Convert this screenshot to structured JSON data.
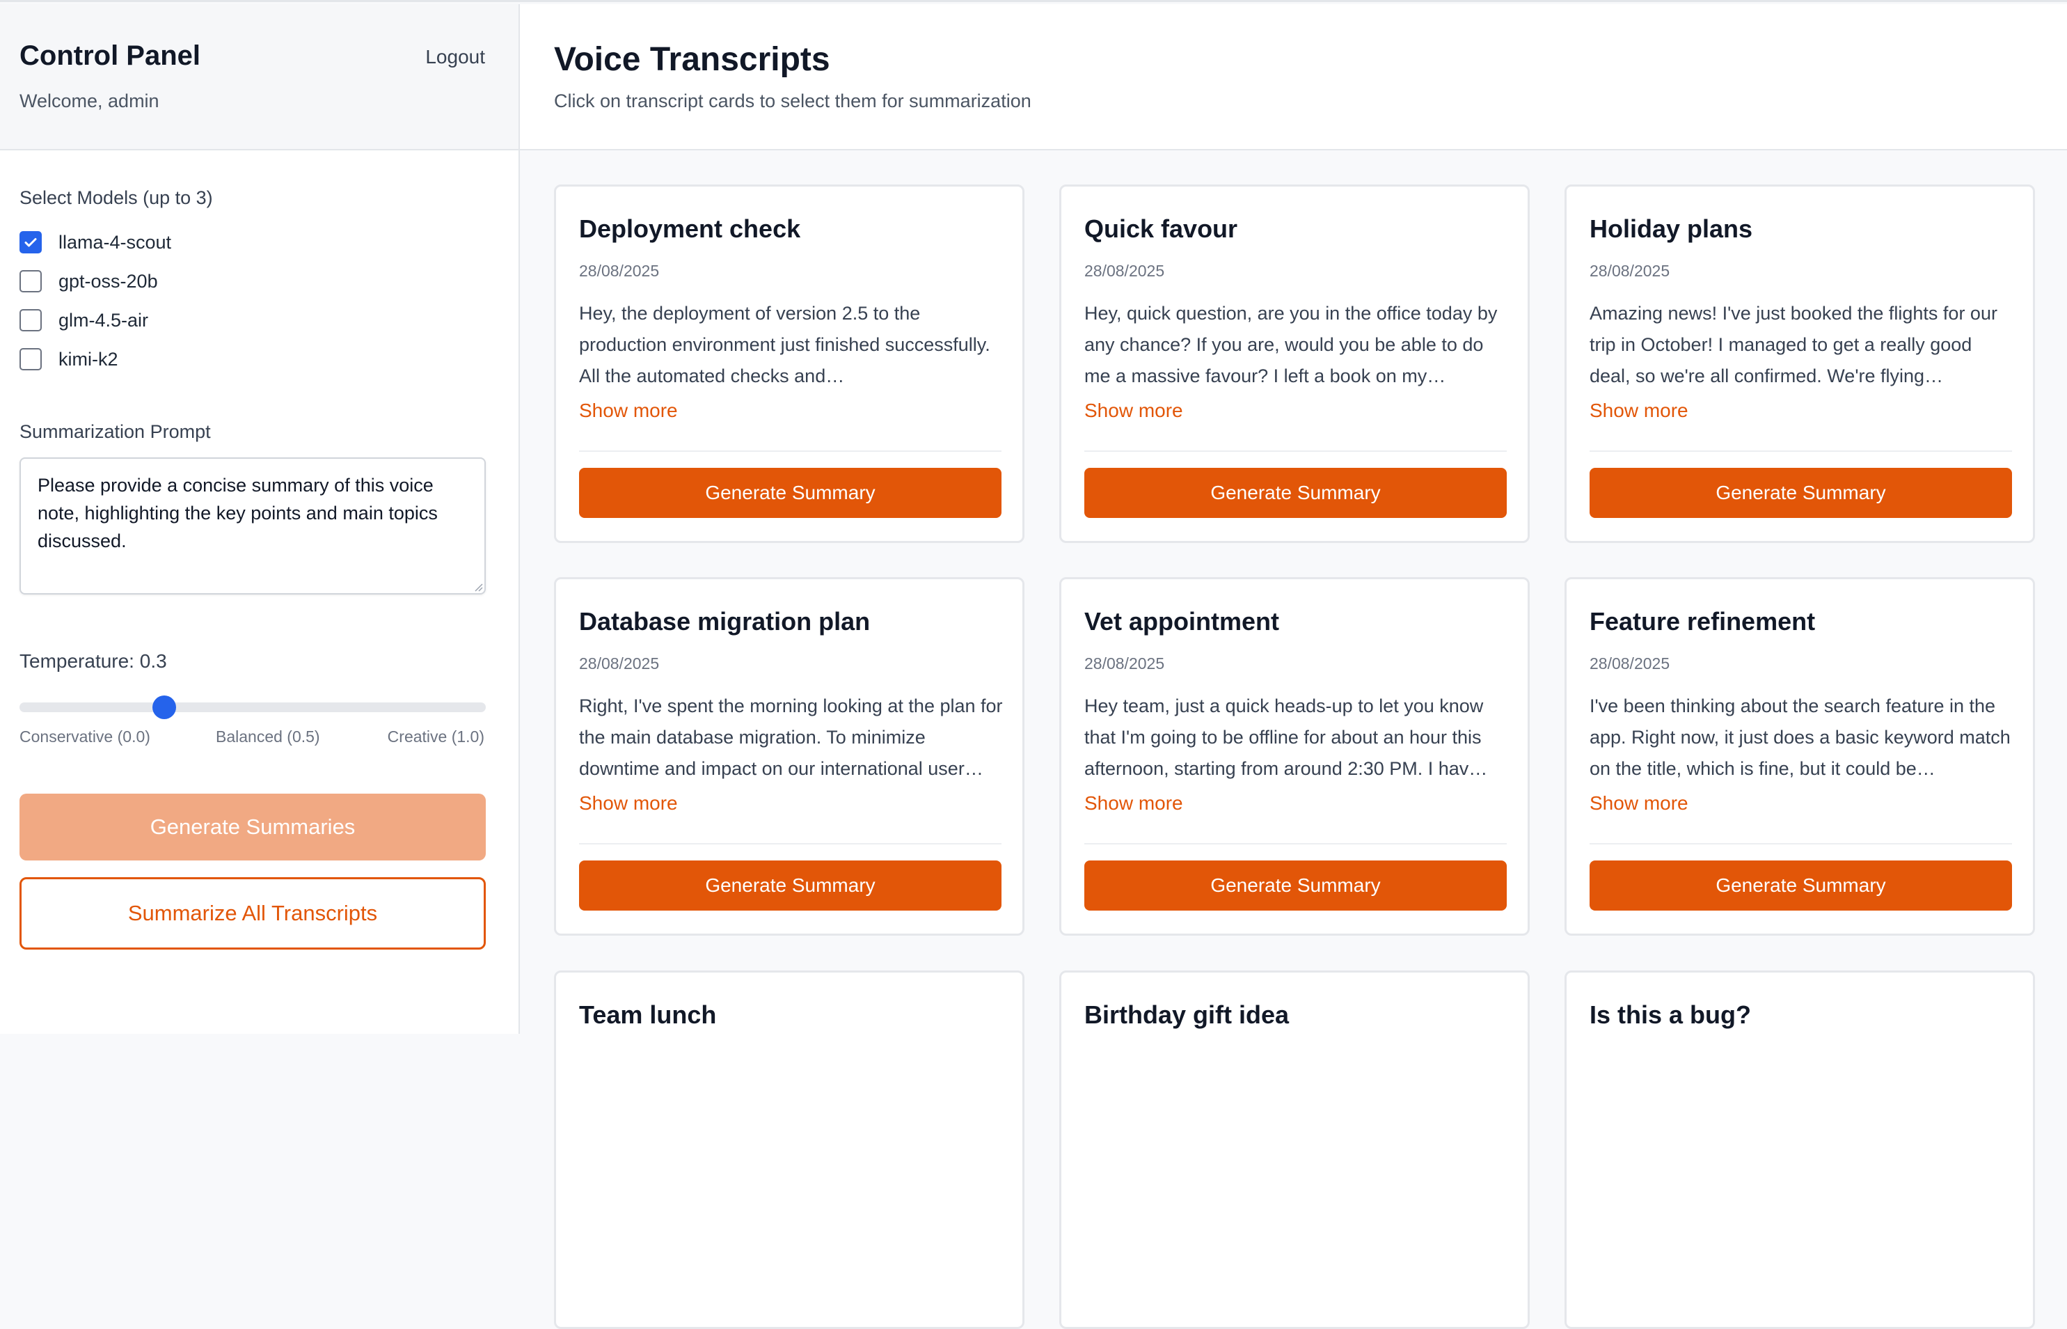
{
  "sidebar": {
    "title": "Control Panel",
    "welcome": "Welcome, admin",
    "logout_label": "Logout",
    "models_label": "Select Models (up to 3)",
    "models": [
      {
        "label": "llama-4-scout",
        "checked": true
      },
      {
        "label": "gpt-oss-20b",
        "checked": false
      },
      {
        "label": "glm-4.5-air",
        "checked": false
      },
      {
        "label": "kimi-k2",
        "checked": false
      }
    ],
    "prompt_label": "Summarization Prompt",
    "prompt_value": "Please provide a concise summary of this voice note, highlighting the key points and main topics discussed.",
    "temperature_label": "Temperature: 0.3",
    "temperature_value": 0.3,
    "slider_min_label": "Conservative (0.0)",
    "slider_mid_label": "Balanced (0.5)",
    "slider_max_label": "Creative (1.0)",
    "generate_summaries_label": "Generate Summaries",
    "summarize_all_label": "Summarize All Transcripts"
  },
  "main": {
    "title": "Voice Transcripts",
    "subtitle": "Click on transcript cards to select them for summarization",
    "show_more_label": "Show more",
    "card_button_label": "Generate Summary",
    "cards": [
      {
        "title": "Deployment check",
        "date": "28/08/2025",
        "text": "Hey, the deployment of version 2.5 to the production environment just finished successfully. All the automated checks and…"
      },
      {
        "title": "Quick favour",
        "date": "28/08/2025",
        "text": "Hey, quick question, are you in the office today by any chance? If you are, would you be able to do me a massive favour? I left a book on my…"
      },
      {
        "title": "Holiday plans",
        "date": "28/08/2025",
        "text": "Amazing news! I've just booked the flights for our trip in October! I managed to get a really good deal, so we're all confirmed. We're flying…"
      },
      {
        "title": "Database migration plan",
        "date": "28/08/2025",
        "text": "Right, I've spent the morning looking at the plan for the main database migration. To minimize downtime and impact on our international user…"
      },
      {
        "title": "Vet appointment",
        "date": "28/08/2025",
        "text": "Hey team, just a quick heads-up to let you know that I'm going to be offline for about an hour this afternoon, starting from around 2:30 PM. I hav…"
      },
      {
        "title": "Feature refinement",
        "date": "28/08/2025",
        "text": "I've been thinking about the search feature in the app. Right now, it just does a basic keyword match on the title, which is fine, but it could be…"
      },
      {
        "title": "Team lunch"
      },
      {
        "title": "Birthday gift idea"
      },
      {
        "title": "Is this a bug?"
      }
    ]
  },
  "colors": {
    "accent": "#e25608",
    "accent_disabled": "#f1a983",
    "checkbox_blue": "#2563eb"
  },
  "icons": {
    "checkbox_checked": "check-icon",
    "textarea_resize": "resize-grip-icon"
  }
}
